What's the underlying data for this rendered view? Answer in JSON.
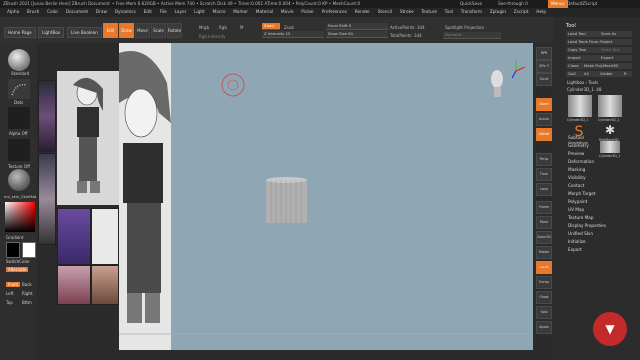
{
  "titlebar": {
    "title": "ZBrush 2021 [Jonas Berlin Hero] ZBrush Document",
    "stats": "• Free Mem 6.620GB • Active Mem 740 • Scratch Disk 49 • Timer:0.001 ATime:0.004 • PolyCount:0 KP • MeshCount:0",
    "quicksave": "QuickSave",
    "seethrough": "See-through  0",
    "menus": "Menus",
    "script": "DefaultZScript"
  },
  "menubar": [
    "Alpha",
    "Brush",
    "Color",
    "Document",
    "Draw",
    "Dynamics",
    "Edit",
    "File",
    "Layer",
    "Light",
    "Macro",
    "Marker",
    "Material",
    "Movie",
    "Picker",
    "Preferences",
    "Render",
    "Stencil",
    "Stroke",
    "Texture",
    "Tool",
    "Transform",
    "Zplugin",
    "Zscript",
    "Help"
  ],
  "shelf": {
    "home": "Home Page",
    "lightbox": "LightBox",
    "livebool": "Live Boolean",
    "edit": "Edit",
    "draw": "Draw",
    "move": "Move",
    "scale": "Scale",
    "rotate": "Rotate",
    "mrgb": "Mrgb",
    "rgb": "Rgb",
    "m": "M",
    "zadd": "Zadd",
    "zsub": "Zsub",
    "intensity": "Z Intensity 25",
    "rgb_intensity": "Rgb Intensity",
    "focal": "Focal Shift 0",
    "drawsize": "Draw Size 64",
    "activepoints": "ActivePoints: 344",
    "totalpoints": "TotalPoints: 344",
    "spotlight": "Spotlight Projection",
    "dynamic": "Dynamic"
  },
  "left": {
    "standard": "Standard",
    "dots": "Dots",
    "alpha": "Alpha Off",
    "texture": "Texture Off",
    "material": "mc_skin_SkinMat",
    "gradient": "Gradient",
    "switchcolor": "SwitchColor",
    "alternate": "Alternate",
    "front": "Front",
    "back": "Back",
    "left": "Left",
    "right": "Right",
    "top": "Top",
    "bttm": "Bttm"
  },
  "rtools": [
    "BPR",
    "SPix 3",
    "Scroll",
    "Zoom",
    "Actual",
    "AAHalf",
    "Persp",
    "Floor",
    "Local",
    "Frame",
    "Move",
    "Zoom3D",
    "Rotate",
    "Line Fill PolyF",
    "Transp",
    "Ghost",
    "Solo",
    "Xpose"
  ],
  "toolpal": {
    "title": "Tool",
    "load": "Load Tool",
    "saveas": "Save As",
    "loadproj": "Load Tools From Project",
    "copy": "Copy Tool",
    "paste": "Paste Tool",
    "import": "Import",
    "export": "Export",
    "clone": "Clone",
    "makepoly": "Make PolyMesh3D",
    "goz": "GoZ",
    "all": "All",
    "visible": "Visible",
    "r": "R",
    "lightbox": "Lightbox › Tools",
    "current": "Cylinder3D_1. 48",
    "thumbs": [
      "Cylinder3D_1",
      "Cylinder3D_1",
      "PolyMesh3D",
      "SimpleBrush",
      "Cylinder3D_1"
    ],
    "items": [
      "Subtool",
      "Geometry",
      "Preview",
      "Deformation",
      "Masking",
      "Visibility",
      "Contact",
      "Morph Target",
      "Polypaint",
      "UV Map",
      "Texture Map",
      "Display Properties",
      "Unified Skin",
      "Initialize",
      "Export"
    ]
  }
}
